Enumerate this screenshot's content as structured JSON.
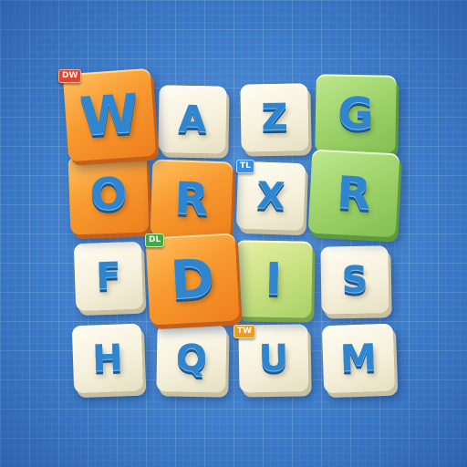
{
  "colors": {
    "background": "#3d7cc9",
    "letter": "#2f86cf",
    "tile_cream": "#f6f1dc",
    "tile_orange": "#f89a30",
    "tile_green": "#9ed36a"
  },
  "board": {
    "rows": [
      [
        {
          "letter": "W",
          "color": "orange",
          "highlight": true
        },
        {
          "letter": "A",
          "color": "cream",
          "highlight": false
        },
        {
          "letter": "Z",
          "color": "cream",
          "highlight": false
        },
        {
          "letter": "G",
          "color": "green",
          "highlight": true
        }
      ],
      [
        {
          "letter": "O",
          "color": "orange",
          "highlight": true
        },
        {
          "letter": "R",
          "color": "orange",
          "highlight": true
        },
        {
          "letter": "X",
          "color": "cream",
          "highlight": false
        },
        {
          "letter": "R",
          "color": "green",
          "highlight": true
        }
      ],
      [
        {
          "letter": "F",
          "color": "cream",
          "highlight": false
        },
        {
          "letter": "D",
          "color": "orange",
          "highlight": true
        },
        {
          "letter": "I",
          "color": "green",
          "highlight": true
        },
        {
          "letter": "S",
          "color": "cream",
          "highlight": false
        }
      ],
      [
        {
          "letter": "H",
          "color": "cream",
          "highlight": false
        },
        {
          "letter": "Q",
          "color": "cream",
          "highlight": false
        },
        {
          "letter": "U",
          "color": "cream",
          "highlight": false
        },
        {
          "letter": "M",
          "color": "cream",
          "highlight": false
        }
      ]
    ]
  },
  "badges": {
    "dw": "DW",
    "tl": "TL",
    "dl": "DL",
    "tw": "TW"
  }
}
